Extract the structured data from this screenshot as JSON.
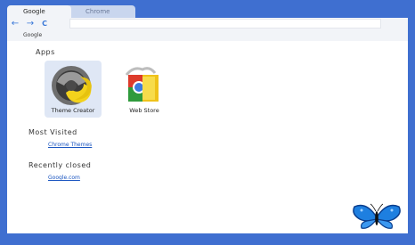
{
  "tabs": [
    {
      "label": "Google",
      "active": true
    },
    {
      "label": "Chrome",
      "active": false
    }
  ],
  "toolbar": {
    "back_icon": "←",
    "forward_icon": "→",
    "reload_icon": "C"
  },
  "bookmarks_bar": {
    "items": [
      "Google"
    ]
  },
  "apps_section": {
    "title": "Apps",
    "items": [
      {
        "label": "Theme Creator",
        "icon": "theme-creator-icon"
      },
      {
        "label": "Web Store",
        "icon": "web-store-icon"
      }
    ]
  },
  "most_visited": {
    "title": "Most Visited",
    "links": [
      "Chrome Themes"
    ]
  },
  "recently_closed": {
    "title": "Recently closed",
    "links": [
      "Google.com"
    ]
  },
  "colors": {
    "frame": "#3f6fd0",
    "toolbar": "#f2f4f8",
    "link": "#1a55c0",
    "butterfly": "#1e7fe0"
  }
}
